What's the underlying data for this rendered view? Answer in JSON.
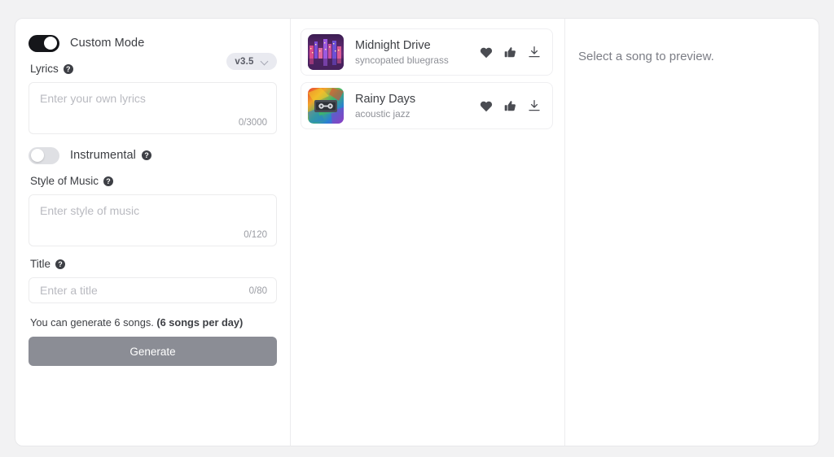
{
  "left_panel": {
    "custom_mode": {
      "label": "Custom Mode",
      "state": "on",
      "icon": "toggle-icon"
    },
    "version_selector": {
      "value": "v3.5",
      "icon": "chevron-down-icon"
    },
    "lyrics": {
      "label": "Lyrics",
      "help_icon": "help-icon",
      "help_glyph": "?",
      "placeholder": "Enter your own lyrics",
      "value": "",
      "counter": "0/3000"
    },
    "instrumental": {
      "label": "Instrumental",
      "state": "off",
      "help_icon": "help-icon",
      "help_glyph": "?"
    },
    "style_of_music": {
      "label": "Style of Music",
      "help_icon": "help-icon",
      "help_glyph": "?",
      "placeholder": "Enter style of music",
      "value": "",
      "counter": "0/120"
    },
    "title": {
      "label": "Title",
      "help_icon": "help-icon",
      "help_glyph": "?",
      "placeholder": "Enter a title",
      "value": "",
      "counter": "0/80"
    },
    "quota": {
      "text": "You can generate 6 songs. ",
      "bold_text": "(6 songs per day)"
    },
    "generate_button": {
      "label": "Generate"
    }
  },
  "song_list": {
    "items": [
      {
        "title": "Midnight Drive",
        "subtitle": "syncopated bluegrass",
        "artwork": "neon-cityscape-artwork",
        "actions": {
          "like": "heart-icon",
          "thumbs_up": "thumbs-up-icon",
          "download": "download-icon"
        }
      },
      {
        "title": "Rainy Days",
        "subtitle": "acoustic jazz",
        "artwork": "cassette-tape-artwork",
        "actions": {
          "like": "heart-icon",
          "thumbs_up": "thumbs-up-icon",
          "download": "download-icon"
        }
      }
    ]
  },
  "preview_panel": {
    "message": "Select a song to preview."
  },
  "colors": {
    "page_background": "#f2f2f3",
    "card_background": "#ffffff",
    "border": "#e8e8ea",
    "toggle_on": "#15161a",
    "toggle_off": "#dfe0e4",
    "generate_button": "#8b8d95",
    "version_pill": "#e9eaf0",
    "primary_text": "#3e4045",
    "muted_text": "#8e9097",
    "placeholder_text": "#b9bac0"
  }
}
